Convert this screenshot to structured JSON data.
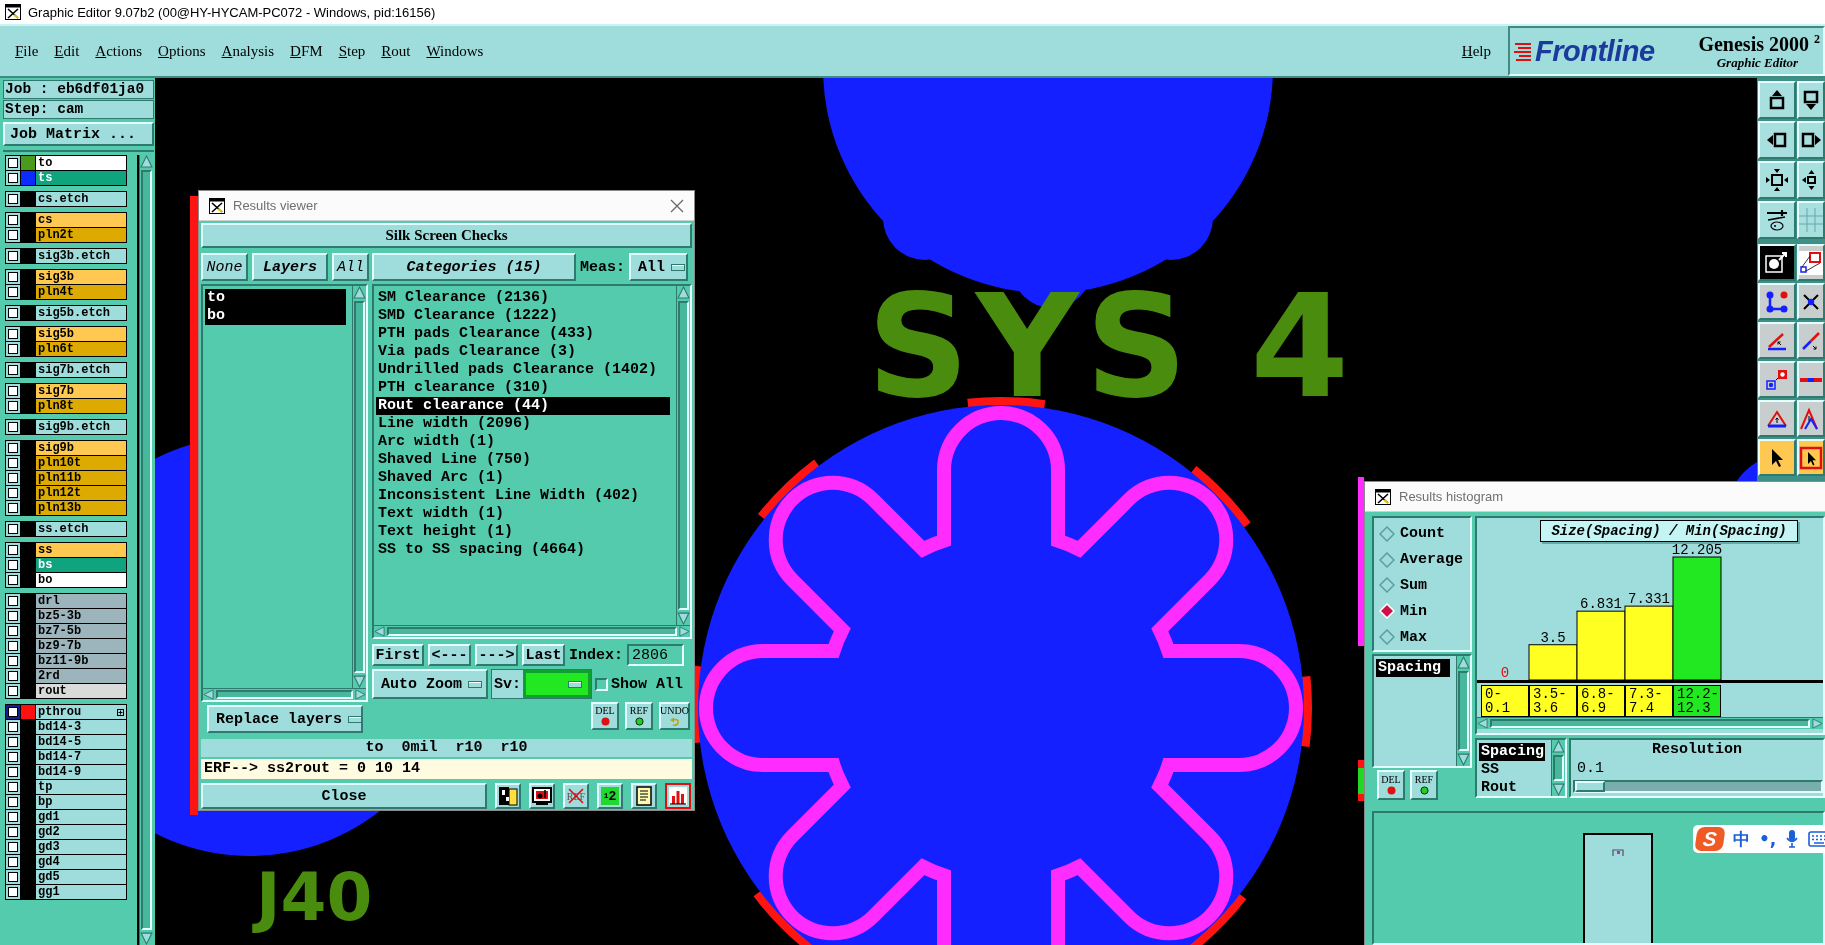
{
  "window": {
    "title": "Graphic Editor 9.07b2 (00@HY-HYCAM-PC072 - Windows, pid:16156)"
  },
  "menu": {
    "items": [
      "File",
      "Edit",
      "Actions",
      "Options",
      "Analysis",
      "DFM",
      "Step",
      "Rout",
      "Windows"
    ],
    "help": "Help"
  },
  "brand": {
    "logo": "Frontline",
    "product": "Genesis 2000 $^{2}$",
    "subtitle": "Graphic Editor"
  },
  "job_panel": {
    "job": "Job : eb6df01ja0",
    "step": "Step: cam",
    "matrix_button": "Job Matrix ...",
    "layer_groups": [
      [
        {
          "name": "to",
          "kind": "silk_screen",
          "color": "#4a9a1e",
          "checked": false,
          "work_layer": false
        },
        {
          "name": "ts",
          "kind": "solder_mask",
          "color": "#0a2cff",
          "checked": false,
          "work_layer": false
        }
      ],
      [
        {
          "name": "cs.etch",
          "kind": "document",
          "checked": false,
          "work_layer": false
        }
      ],
      [
        {
          "name": "cs",
          "kind": "signal",
          "checked": false,
          "work_layer": false
        },
        {
          "name": "pln2t",
          "kind": "power_ground",
          "checked": false,
          "work_layer": false
        }
      ],
      [
        {
          "name": "sig3b.etch",
          "kind": "document",
          "checked": false,
          "work_layer": false
        }
      ],
      [
        {
          "name": "sig3b",
          "kind": "signal",
          "checked": false,
          "work_layer": false
        },
        {
          "name": "pln4t",
          "kind": "power_ground",
          "checked": false,
          "work_layer": false
        }
      ],
      [
        {
          "name": "sig5b.etch",
          "kind": "document",
          "checked": false,
          "work_layer": false
        }
      ],
      [
        {
          "name": "sig5b",
          "kind": "signal",
          "checked": false,
          "work_layer": false
        },
        {
          "name": "pln6t",
          "kind": "power_ground",
          "checked": false,
          "work_layer": false
        }
      ],
      [
        {
          "name": "sig7b.etch",
          "kind": "document",
          "checked": false,
          "work_layer": false
        }
      ],
      [
        {
          "name": "sig7b",
          "kind": "signal",
          "checked": false,
          "work_layer": false
        },
        {
          "name": "pln8t",
          "kind": "power_ground",
          "checked": false,
          "work_layer": false
        }
      ],
      [
        {
          "name": "sig9b.etch",
          "kind": "document",
          "checked": false,
          "work_layer": false
        }
      ],
      [
        {
          "name": "sig9b",
          "kind": "signal",
          "checked": false,
          "work_layer": false
        },
        {
          "name": "pln10t",
          "kind": "power_ground",
          "checked": false,
          "work_layer": false
        },
        {
          "name": "pln11b",
          "kind": "power_ground",
          "checked": false,
          "work_layer": false
        },
        {
          "name": "pln12t",
          "kind": "power_ground",
          "checked": false,
          "work_layer": false
        },
        {
          "name": "pln13b",
          "kind": "power_ground",
          "checked": false,
          "work_layer": false
        }
      ],
      [
        {
          "name": "ss.etch",
          "kind": "document",
          "checked": false,
          "work_layer": false
        }
      ],
      [
        {
          "name": "ss",
          "kind": "signal",
          "checked": false,
          "work_layer": false
        },
        {
          "name": "bs",
          "kind": "solder_mask",
          "checked": false,
          "work_layer": false
        },
        {
          "name": "bo",
          "kind": "silk_screen",
          "checked": false,
          "work_layer": false
        }
      ],
      [
        {
          "name": "drl",
          "kind": "drill",
          "checked": false,
          "work_layer": false
        },
        {
          "name": "bz5-3b",
          "kind": "drill",
          "checked": false,
          "work_layer": false
        },
        {
          "name": "bz7-5b",
          "kind": "drill",
          "checked": false,
          "work_layer": false
        },
        {
          "name": "bz9-7b",
          "kind": "drill",
          "checked": false,
          "work_layer": false
        },
        {
          "name": "bz11-9b",
          "kind": "drill",
          "checked": false,
          "work_layer": false
        },
        {
          "name": "2rd",
          "kind": "drill",
          "checked": false,
          "work_layer": false
        },
        {
          "name": "rout",
          "kind": "rout",
          "checked": false,
          "work_layer": false
        }
      ],
      [
        {
          "name": "pthrou",
          "kind": "document",
          "color": "#ff1010",
          "checked": false,
          "work_layer": true
        },
        {
          "name": "bd14-3",
          "kind": "document",
          "checked": false,
          "work_layer": false
        },
        {
          "name": "bd14-5",
          "kind": "document",
          "checked": false,
          "work_layer": false
        },
        {
          "name": "bd14-7",
          "kind": "document",
          "checked": false,
          "work_layer": false
        },
        {
          "name": "bd14-9",
          "kind": "document",
          "checked": false,
          "work_layer": false
        },
        {
          "name": "tp",
          "kind": "document",
          "checked": false,
          "work_layer": false
        },
        {
          "name": "bp",
          "kind": "document",
          "checked": false,
          "work_layer": false
        },
        {
          "name": "gd1",
          "kind": "document",
          "checked": false,
          "work_layer": false
        },
        {
          "name": "gd2",
          "kind": "document",
          "checked": false,
          "work_layer": false
        },
        {
          "name": "gd3",
          "kind": "document",
          "checked": false,
          "work_layer": false
        },
        {
          "name": "gd4",
          "kind": "document",
          "checked": false,
          "work_layer": false
        },
        {
          "name": "gd5",
          "kind": "document",
          "checked": false,
          "work_layer": false
        },
        {
          "name": "gg1",
          "kind": "document",
          "checked": false,
          "work_layer": false
        }
      ]
    ]
  },
  "canvas": {
    "texts": [
      "SYS 4",
      "J40"
    ]
  },
  "results_viewer": {
    "title": "Results viewer",
    "heading": "Silk Screen Checks",
    "layer_buttons": {
      "none": "None",
      "title": "Layers",
      "all": "All"
    },
    "layers": [
      {
        "name": "to",
        "selected": true
      },
      {
        "name": "bo",
        "selected": true
      }
    ],
    "replace_mode": "Replace layers",
    "categories_title": "Categories (15)",
    "meas": {
      "label": "Meas:",
      "value": "All"
    },
    "categories": [
      {
        "name": "SM Clearance (2136)",
        "selected": false
      },
      {
        "name": "SMD Clearance (1222)",
        "selected": false
      },
      {
        "name": "PTH pads Clearance (433)",
        "selected": false
      },
      {
        "name": "Via pads Clearance (3)",
        "selected": false
      },
      {
        "name": "Undrilled pads Clearance (1402)",
        "selected": false
      },
      {
        "name": "PTH clearance (310)",
        "selected": false
      },
      {
        "name": "Rout clearance (44)",
        "selected": true
      },
      {
        "name": "Line width (2096)",
        "selected": false
      },
      {
        "name": "Arc width (1)",
        "selected": false
      },
      {
        "name": "Shaved Line (750)",
        "selected": false
      },
      {
        "name": "Shaved Arc (1)",
        "selected": false
      },
      {
        "name": "Inconsistent Line Width (402)",
        "selected": false
      },
      {
        "name": "Text width (1)",
        "selected": false
      },
      {
        "name": "Text height (1)",
        "selected": false
      },
      {
        "name": "SS to SS spacing (4664)",
        "selected": false
      }
    ],
    "nav": [
      "First",
      "<---",
      "--->",
      "Last"
    ],
    "index": {
      "label": "Index:",
      "value": "2806"
    },
    "zoom_mode": "Auto Zoom",
    "severity": {
      "label": "Sv:",
      "color": "#22e822"
    },
    "show_all": {
      "label": "Show All",
      "checked": false
    },
    "actions": [
      {
        "kind": "delete",
        "label": "DEL"
      },
      {
        "kind": "reference",
        "label": "REF"
      },
      {
        "kind": "undo",
        "label": "UNDO"
      }
    ],
    "status": "to  0mil  r10  r10",
    "erf": "ERF--> ss2rout = 0 10 14",
    "close": "Close",
    "tools": [
      {
        "kind": "split",
        "selected": false
      },
      {
        "kind": "monitor",
        "selected": false
      },
      {
        "kind": "ref_off",
        "label": "REF",
        "selected": false
      },
      {
        "kind": "numbers",
        "label": "$^{1}$2",
        "selected": false
      },
      {
        "kind": "report",
        "selected": false
      },
      {
        "kind": "histogram",
        "selected": true
      }
    ]
  },
  "histogram": {
    "title": "Results histogram",
    "modes": [
      {
        "label": "Count",
        "selected": false
      },
      {
        "label": "Average",
        "selected": false
      },
      {
        "label": "Sum",
        "selected": false
      },
      {
        "label": "Min",
        "selected": true
      },
      {
        "label": "Max",
        "selected": false
      }
    ],
    "measures": [
      {
        "name": "Spacing",
        "selected": true
      }
    ],
    "actions": [
      {
        "kind": "delete",
        "label": "DEL"
      },
      {
        "kind": "reference",
        "label": "REF"
      }
    ],
    "chart_data": {
      "type": "bar",
      "title": "Size(Spacing) / Min(Spacing)",
      "categories": [
        "0-0.1",
        "3.5-3.6",
        "6.8-6.9",
        "7.3-7.4",
        "12.2-12.3"
      ],
      "values": [
        0,
        3.5,
        6.831,
        7.331,
        12.205
      ],
      "data_labels": true
    },
    "bins": [
      {
        "selected": false
      },
      {
        "selected": false
      },
      {
        "selected": false
      },
      {
        "selected": false
      },
      {
        "selected": true
      }
    ],
    "fields": [
      {
        "name": "Spacing",
        "selected": true
      },
      {
        "name": "SS",
        "selected": false
      },
      {
        "name": "Rout",
        "selected": false
      }
    ],
    "resolution": {
      "label": "Resolution",
      "value": "0.1",
      "level": 0
    }
  },
  "toolbar": {
    "groups": [
      [
        {
          "kind": "move_up",
          "selected": false
        },
        {
          "kind": "move_down",
          "selected": false
        },
        {
          "kind": "move_left",
          "selected": false
        },
        {
          "kind": "move_right",
          "selected": false
        },
        {
          "kind": "zoom_fit",
          "selected": false
        },
        {
          "kind": "zoom_center",
          "selected": false
        },
        {
          "kind": "tools",
          "selected": false
        },
        {
          "kind": "grid",
          "selected": false
        }
      ],
      [
        {
          "kind": "snap",
          "selected": true
        },
        {
          "kind": "box",
          "selected": false
        },
        {
          "kind": "nodes",
          "selected": false
        },
        {
          "kind": "cross",
          "selected": false
        },
        {
          "kind": "angle",
          "selected": false
        },
        {
          "kind": "line",
          "selected": false
        },
        {
          "kind": "pads",
          "selected": false
        },
        {
          "kind": "split",
          "selected": false
        },
        {
          "kind": "triangle",
          "selected": false
        },
        {
          "kind": "peaks",
          "selected": false
        },
        {
          "kind": "pointer",
          "selected": false
        },
        {
          "kind": "pointer_box",
          "selected": false
        }
      ]
    ]
  },
  "ime_bar": {
    "logo": "S",
    "mode": "中",
    "punctuation": "•,"
  }
}
